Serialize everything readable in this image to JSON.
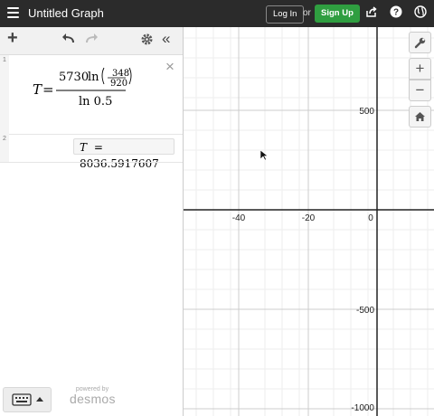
{
  "header": {
    "title": "Untitled Graph",
    "login": "Log In",
    "or": "or",
    "signup": "Sign Up"
  },
  "expressions": [
    {
      "index": "1",
      "lhs": "T",
      "eq": "=",
      "coefficient": "5730",
      "fn": "ln",
      "frac_num": "348",
      "frac_den": "920",
      "denominator": "ln 0.5",
      "result_lhs": "T",
      "result_eq": "=",
      "result_value": "8036.5917607"
    },
    {
      "index": "2"
    }
  ],
  "branding": {
    "powered": "powered by",
    "brand": "desmos"
  },
  "axes": {
    "x_ticks": [
      "-40",
      "-20",
      "0"
    ],
    "y_ticks": [
      "500",
      "-500",
      "-1000"
    ]
  }
}
